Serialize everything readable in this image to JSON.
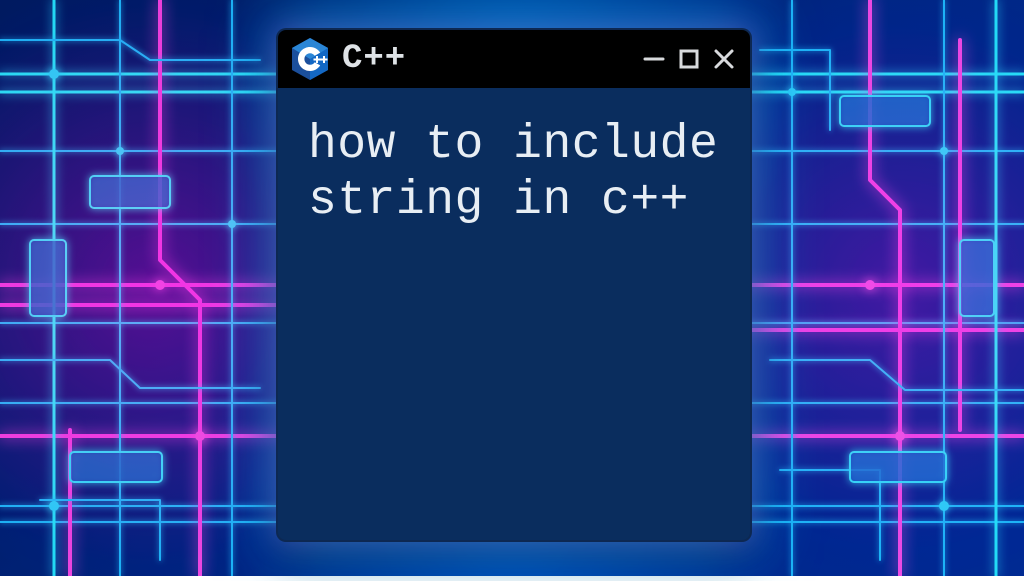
{
  "window": {
    "title": "C++",
    "icon_name": "cpp-logo-icon",
    "controls": {
      "minimize": "minimize",
      "maximize": "maximize",
      "close": "close"
    }
  },
  "content": {
    "text": "how to include string in c++"
  }
}
